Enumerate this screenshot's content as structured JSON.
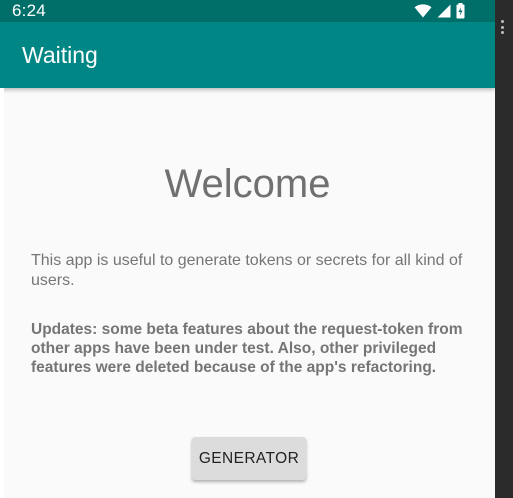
{
  "status_bar": {
    "time": "6:24",
    "icons": [
      "wifi-icon",
      "signal-icon",
      "battery-icon"
    ]
  },
  "app_bar": {
    "title": "Waiting"
  },
  "main": {
    "welcome": "Welcome",
    "description": "This app is useful to generate tokens or secrets for all kind of users.",
    "updates": "Updates: some beta features about the request-token from other apps have been under test. Also, other privileged features were deleted because of the app's refactoring.",
    "generator_button": "GENERATOR"
  },
  "colors": {
    "status_bar": "#006f6a",
    "app_bar": "#008785",
    "background": "#fafafa",
    "text_gray": "#757575",
    "button_bg": "#dcdcdc"
  }
}
